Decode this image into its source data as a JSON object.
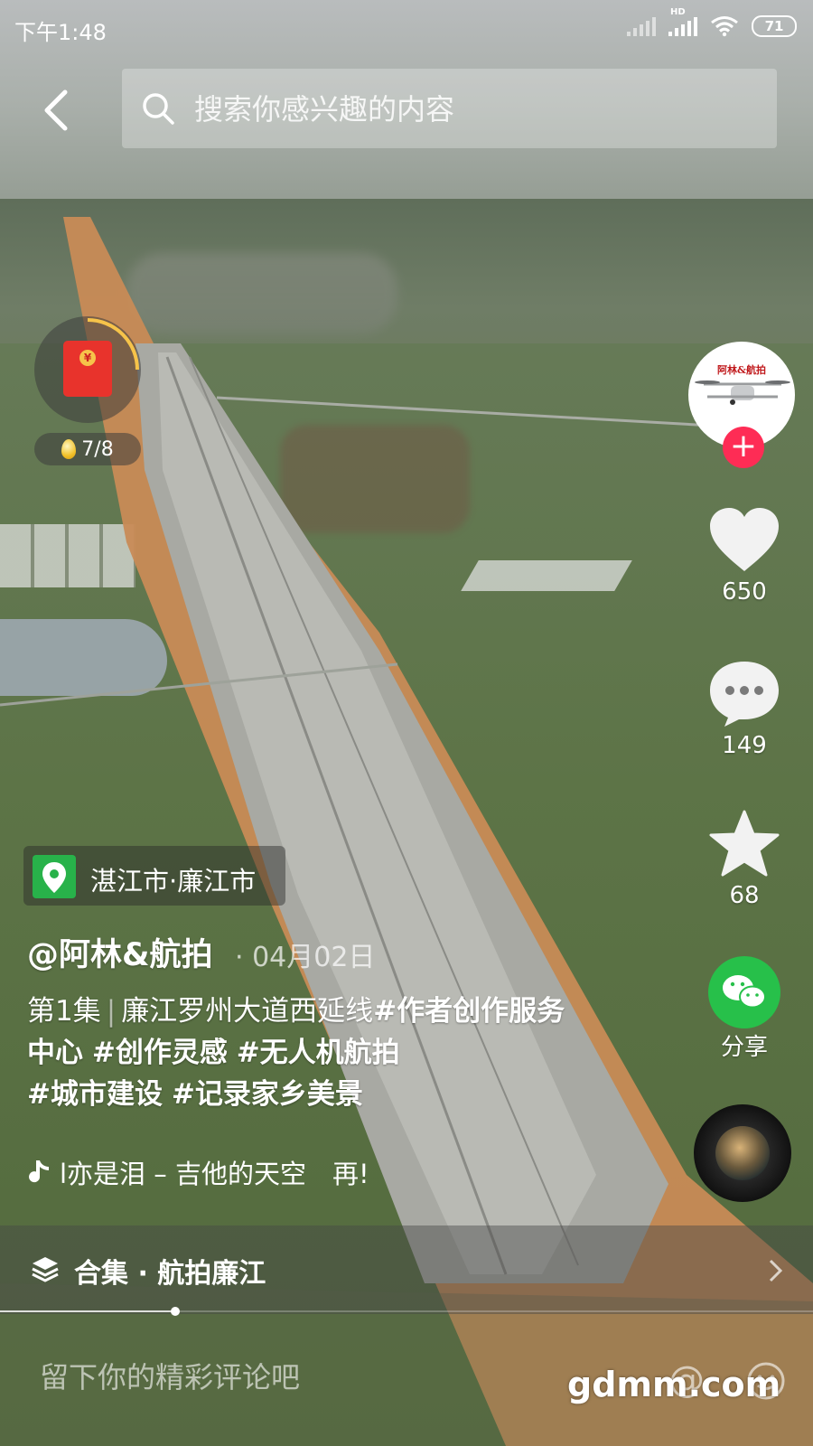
{
  "status_bar": {
    "time": "下午1:48",
    "battery": "71",
    "network_label": "HD"
  },
  "search": {
    "placeholder": "搜索你感兴趣的内容"
  },
  "red_packet": {
    "progress_text": "7/8"
  },
  "right_rail": {
    "like_count": "650",
    "comment_count": "149",
    "favorite_count": "68",
    "share_label": "分享",
    "follow_symbol": "+",
    "avatar_text": "阿林&航拍"
  },
  "location": {
    "label": "湛江市·廉江市"
  },
  "post": {
    "author": "@阿林&航拍",
    "date": "· 04月02日",
    "episode": "第1集",
    "separator": "|",
    "title": "廉江罗州大道西延线",
    "tags": [
      "#作者创作服务中心",
      "#创作灵感",
      "#无人机航拍",
      "#城市建设",
      "#记录家乡美景"
    ]
  },
  "music": {
    "text": "l亦是泪 – 吉他的天空　再!"
  },
  "collection": {
    "label": "合集 · 航拍廉江"
  },
  "playback": {
    "progress": 0.215
  },
  "comment": {
    "placeholder": "留下你的精彩评论吧",
    "at_symbol": "@"
  },
  "watermark": "gdmm.com",
  "colors": {
    "accent_red": "#fe2c55",
    "wechat_green": "#27c04a",
    "location_green": "#28b24a"
  }
}
